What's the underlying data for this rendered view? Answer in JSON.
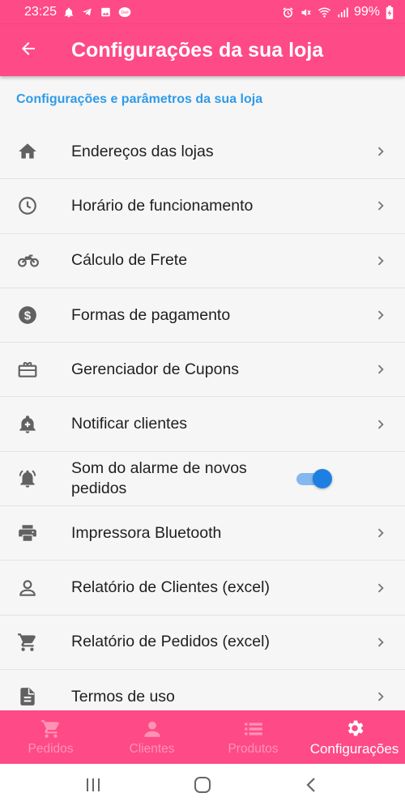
{
  "status_bar": {
    "time": "23:25",
    "battery": "99%",
    "left_icons": [
      "notification-bell-icon",
      "telegram-icon",
      "gallery-icon",
      "app-badge-icon"
    ],
    "right_icons": [
      "alarm-icon",
      "mute-icon",
      "wifi-icon",
      "signal-icon",
      "battery-icon"
    ]
  },
  "app_bar": {
    "title": "Configurações da sua loja",
    "back_icon": "arrow-left-icon"
  },
  "section_header": "Configurações e parâmetros da sua loja",
  "menu": {
    "items": [
      {
        "label": "Endereços das lojas",
        "icon": "home-icon"
      },
      {
        "label": "Horário de funcionamento",
        "icon": "clock-icon"
      },
      {
        "label": "Cálculo de Frete",
        "icon": "motorcycle-icon"
      },
      {
        "label": "Formas de pagamento",
        "icon": "dollar-circle-icon"
      },
      {
        "label": "Gerenciador de Cupons",
        "icon": "gift-card-icon"
      },
      {
        "label": "Notificar clientes",
        "icon": "notification-add-icon"
      },
      {
        "label": "Som do alarme de novos pedidos",
        "icon": "alarm-bell-icon",
        "toggle": true
      },
      {
        "label": "Impressora Bluetooth",
        "icon": "printer-icon"
      },
      {
        "label": "Relatório de Clientes (excel)",
        "icon": "person-icon"
      },
      {
        "label": "Relatório de Pedidos (excel)",
        "icon": "shopping-cart-icon"
      },
      {
        "label": "Termos de uso",
        "icon": "document-icon"
      }
    ]
  },
  "bottom_nav": {
    "items": [
      {
        "label": "Pedidos",
        "icon": "shopping-cart-icon",
        "active": false
      },
      {
        "label": "Clientes",
        "icon": "person-icon",
        "active": false
      },
      {
        "label": "Produtos",
        "icon": "list-icon",
        "active": false
      },
      {
        "label": "Configurações",
        "icon": "gear-icon",
        "active": true
      }
    ]
  },
  "colors": {
    "brand_pink": "#fe4a86",
    "section_header_blue": "#2f9be8",
    "toggle_blue": "#1e7fe2",
    "nav_inactive": "#ff93b6"
  }
}
